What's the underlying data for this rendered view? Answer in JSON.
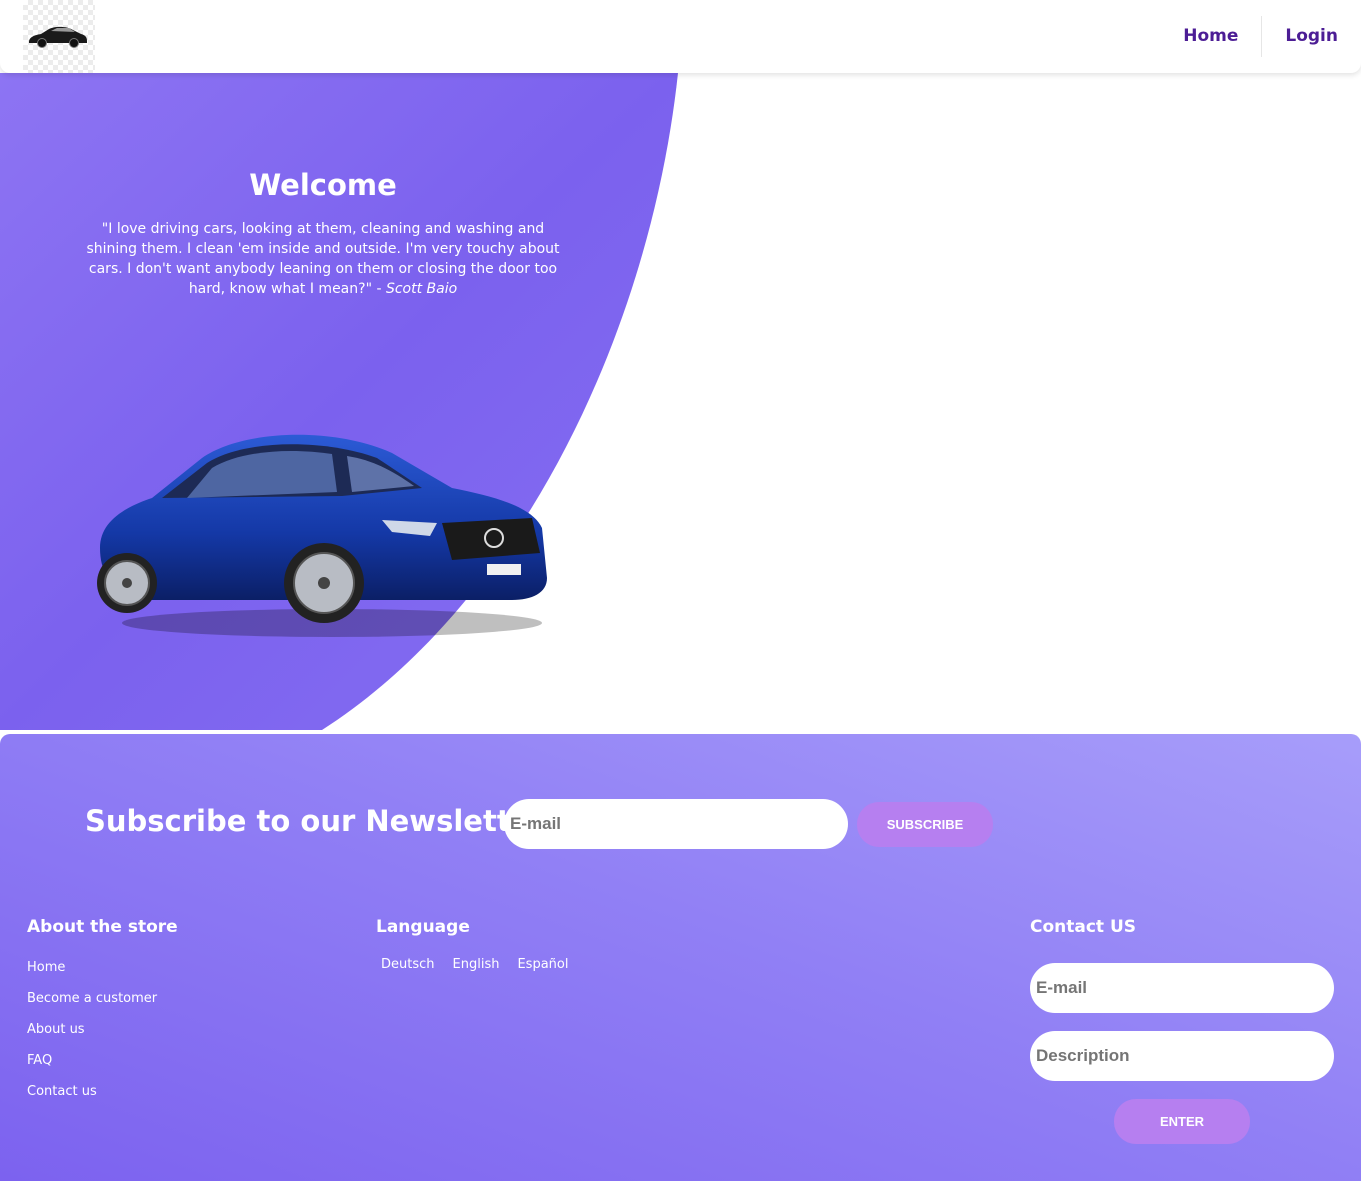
{
  "navbar": {
    "logo_icon": "car-logo-icon",
    "links": [
      "Home",
      "Login"
    ]
  },
  "hero": {
    "title": "Welcome",
    "quote": "\"I love driving cars, looking at them, cleaning and washing and shining them. I clean 'em inside and outside. I'm very touchy about cars. I don't want anybody leaning on them or closing the door too hard, know what I mean?\" - ",
    "quote_author": "Scott Baio",
    "image": "blue-coupe-car-image"
  },
  "newsletter": {
    "title": "Subscribe to our Newsletter",
    "email_placeholder": "E-mail",
    "button": "SUBSCRIBE"
  },
  "footer": {
    "about": {
      "title": "About the store",
      "links": [
        "Home",
        "Become a customer",
        "About us",
        "FAQ",
        "Contact us"
      ]
    },
    "language": {
      "title": "Language",
      "options": [
        "Deutsch",
        "English",
        "Español"
      ]
    },
    "contact": {
      "title": "Contact US",
      "email_placeholder": "E-mail",
      "description_placeholder": "Description",
      "button": "ENTER"
    }
  },
  "colors": {
    "brand_purple": "#7b61ee",
    "nav_text": "#4c1d95",
    "button": "#b67ff0"
  }
}
